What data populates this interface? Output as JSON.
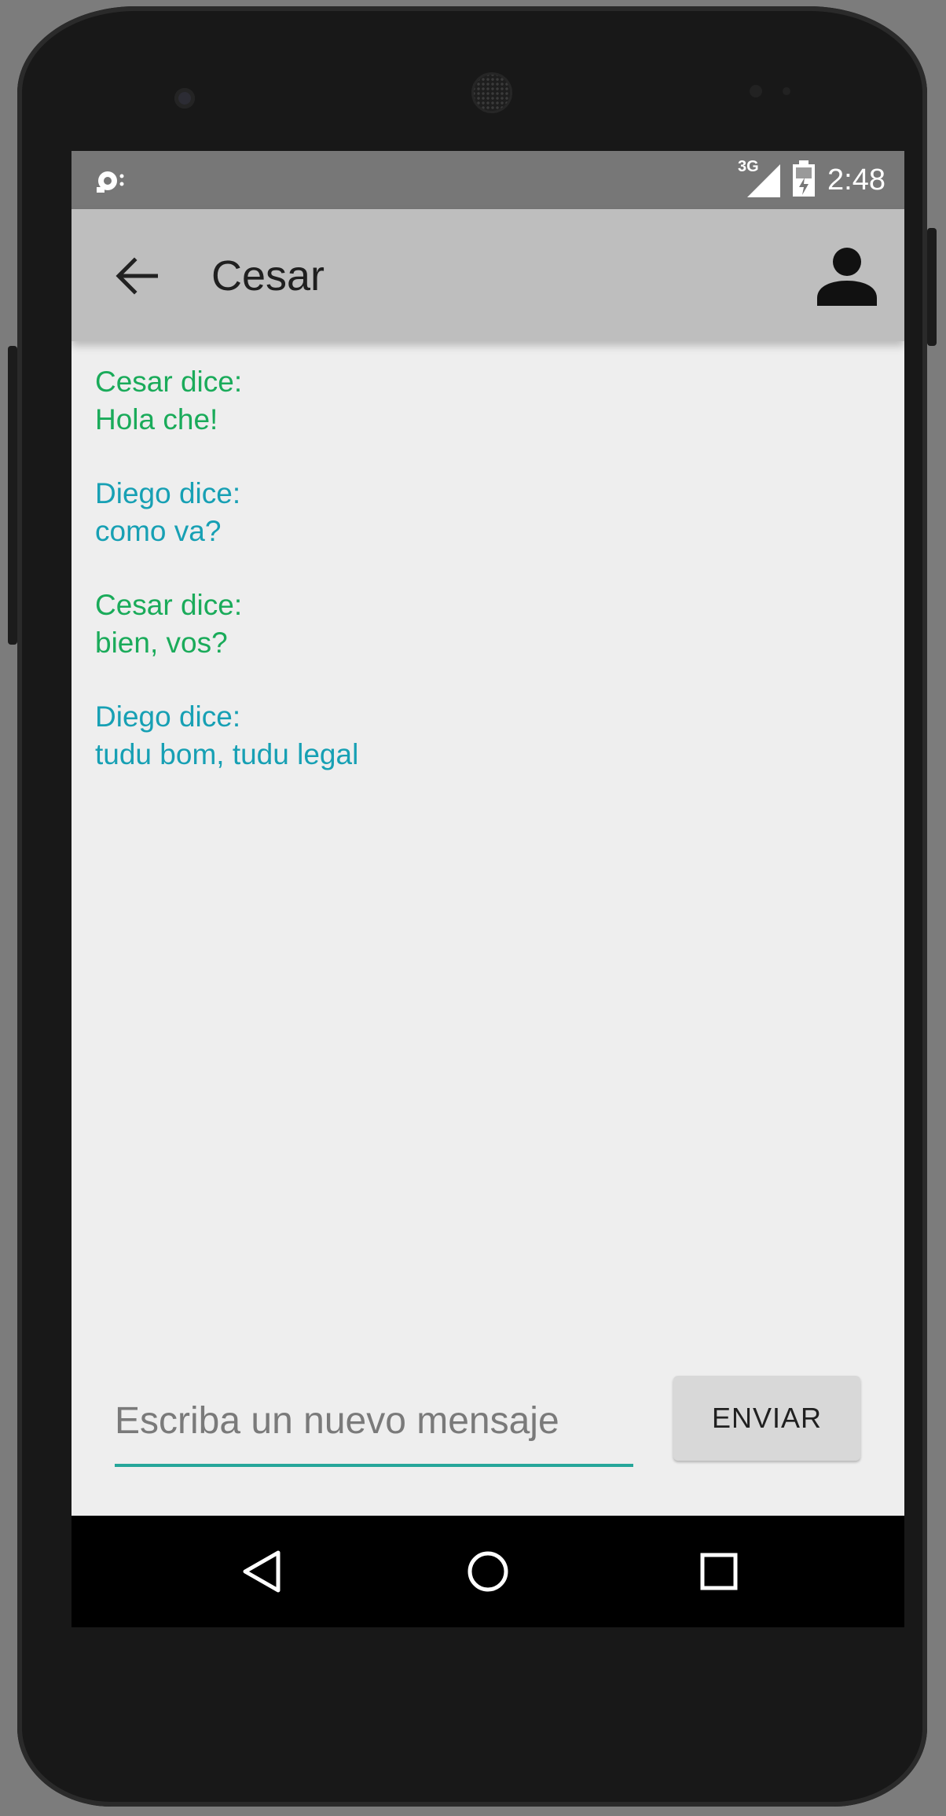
{
  "status_bar": {
    "time": "2:48",
    "network": "3G"
  },
  "toolbar": {
    "title": "Cesar",
    "back_icon": "arrow-back-icon",
    "profile_icon": "person-icon"
  },
  "messages": [
    {
      "sender_line": "Cesar dice:",
      "text": "Hola che!",
      "color": "#1aab5a"
    },
    {
      "sender_line": "Diego dice:",
      "text": "como va?",
      "color": "#17a0b4"
    },
    {
      "sender_line": "Cesar dice:",
      "text": "bien, vos?",
      "color": "#1aab5a"
    },
    {
      "sender_line": "Diego dice:",
      "text": "tudu bom, tudu legal",
      "color": "#17a0b4"
    }
  ],
  "composer": {
    "placeholder": "Escriba un nuevo mensaje",
    "value": "",
    "send_label": "ENVIAR",
    "accent": "#26a69a"
  },
  "nav_bar": {
    "back_icon": "triangle-back-icon",
    "home_icon": "circle-home-icon",
    "recents_icon": "square-recents-icon"
  }
}
